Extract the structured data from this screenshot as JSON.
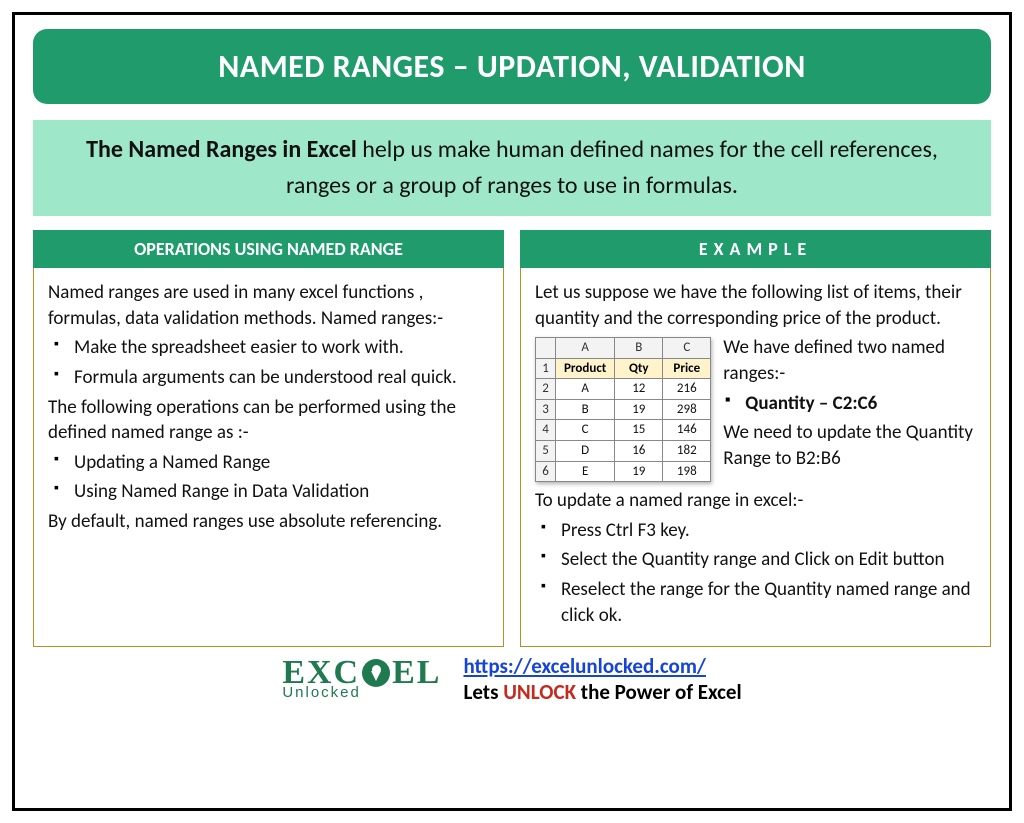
{
  "title": "NAMED RANGES – UPDATION, VALIDATION",
  "intro": {
    "bold": "The Named Ranges in Excel",
    "rest": " help us make human defined names for the cell references, ranges or a group of ranges to use in formulas."
  },
  "left": {
    "header": "OPERATIONS USING NAMED RANGE",
    "p1": "Named ranges are used in many excel functions , formulas, data validation methods. Named ranges:-",
    "b1": "Make the spreadsheet easier to work with.",
    "b2": "Formula arguments can be understood real quick.",
    "p2": "The following operations can be performed using the defined named range as :-",
    "b3": "Updating a Named Range",
    "b4": "Using Named Range in Data Validation",
    "p3": "By default, named ranges use absolute referencing."
  },
  "right": {
    "header": "EXAMPLE",
    "p1": "Let us suppose we have the following list of items, their quantity and the corresponding price of the product.",
    "side_p1": "We have defined two named ranges:-",
    "side_b1": "Quantity –  C2:C6",
    "side_p2": "We need to update the Quantity Range to B2:B6",
    "p2": "To update a named range in excel:-",
    "s1": "Press Ctrl F3 key.",
    "s2": "Select the Quantity range and Click on Edit button",
    "s3": "Reselect the range for the Quantity named range and click ok."
  },
  "table": {
    "colA": "A",
    "colB": "B",
    "colC": "C",
    "h1": "Product",
    "h2": "Qty",
    "h3": "Price",
    "r1": "1",
    "r2": "2",
    "r3": "3",
    "r4": "4",
    "r5": "5",
    "r6": "6",
    "rows": [
      {
        "p": "A",
        "q": "12",
        "pr": "216"
      },
      {
        "p": "B",
        "q": "19",
        "pr": "298"
      },
      {
        "p": "C",
        "q": "15",
        "pr": "146"
      },
      {
        "p": "D",
        "q": "16",
        "pr": "182"
      },
      {
        "p": "E",
        "q": "19",
        "pr": "198"
      }
    ]
  },
  "footer": {
    "logo_main_1": "EXC",
    "logo_main_2": "EL",
    "logo_sub": "Unlocked",
    "url": "https://excelunlocked.com/",
    "tag_1": "Lets ",
    "tag_unlock": "UNLOCK",
    "tag_2": " the Power of Excel"
  }
}
